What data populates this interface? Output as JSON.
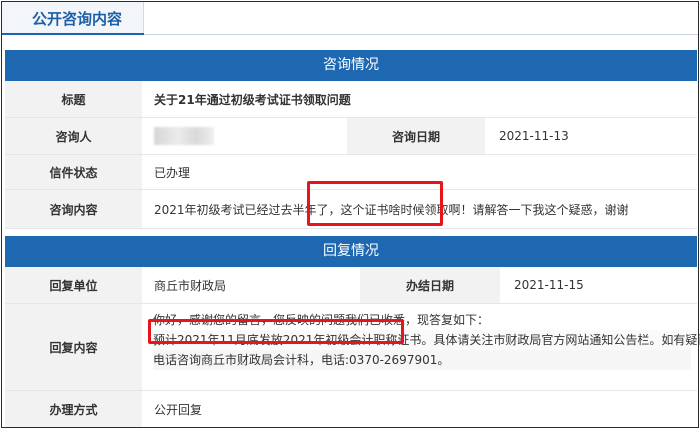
{
  "tab": {
    "label": "公开咨询内容"
  },
  "consult": {
    "header": "咨询情况",
    "title_label": "标题",
    "title_value": "关于21年通过初级考试证书领取问题",
    "person_label": "咨询人",
    "date_label": "咨询日期",
    "date_value": "2021-11-13",
    "status_label": "信件状态",
    "status_value": "已办理",
    "content_label": "咨询内容",
    "content_value": "2021年初级考试已经过去半年了，这个证书啥时候领取啊！请解答一下我这个疑惑，谢谢"
  },
  "reply": {
    "header": "回复情况",
    "unit_label": "回复单位",
    "unit_value": "商丘市财政局",
    "finish_date_label": "办结日期",
    "finish_date_value": "2021-11-15",
    "content_label": "回复内容",
    "content_lines": [
      "你好，感谢您的留言，您反映的问题我们已收悉，现答复如下：",
      "预计2021年11月底发放2021年初级会计职称证书。具体请关注市财政局官方网站通知公告栏。如有疑问，请",
      "电话咨询商丘市财政局会计科，电话:0370-2697901。"
    ],
    "method_label": "办理方式",
    "method_value": "公开回复"
  },
  "highlight_color": "#e8141a",
  "accent_color": "#1e67b1"
}
